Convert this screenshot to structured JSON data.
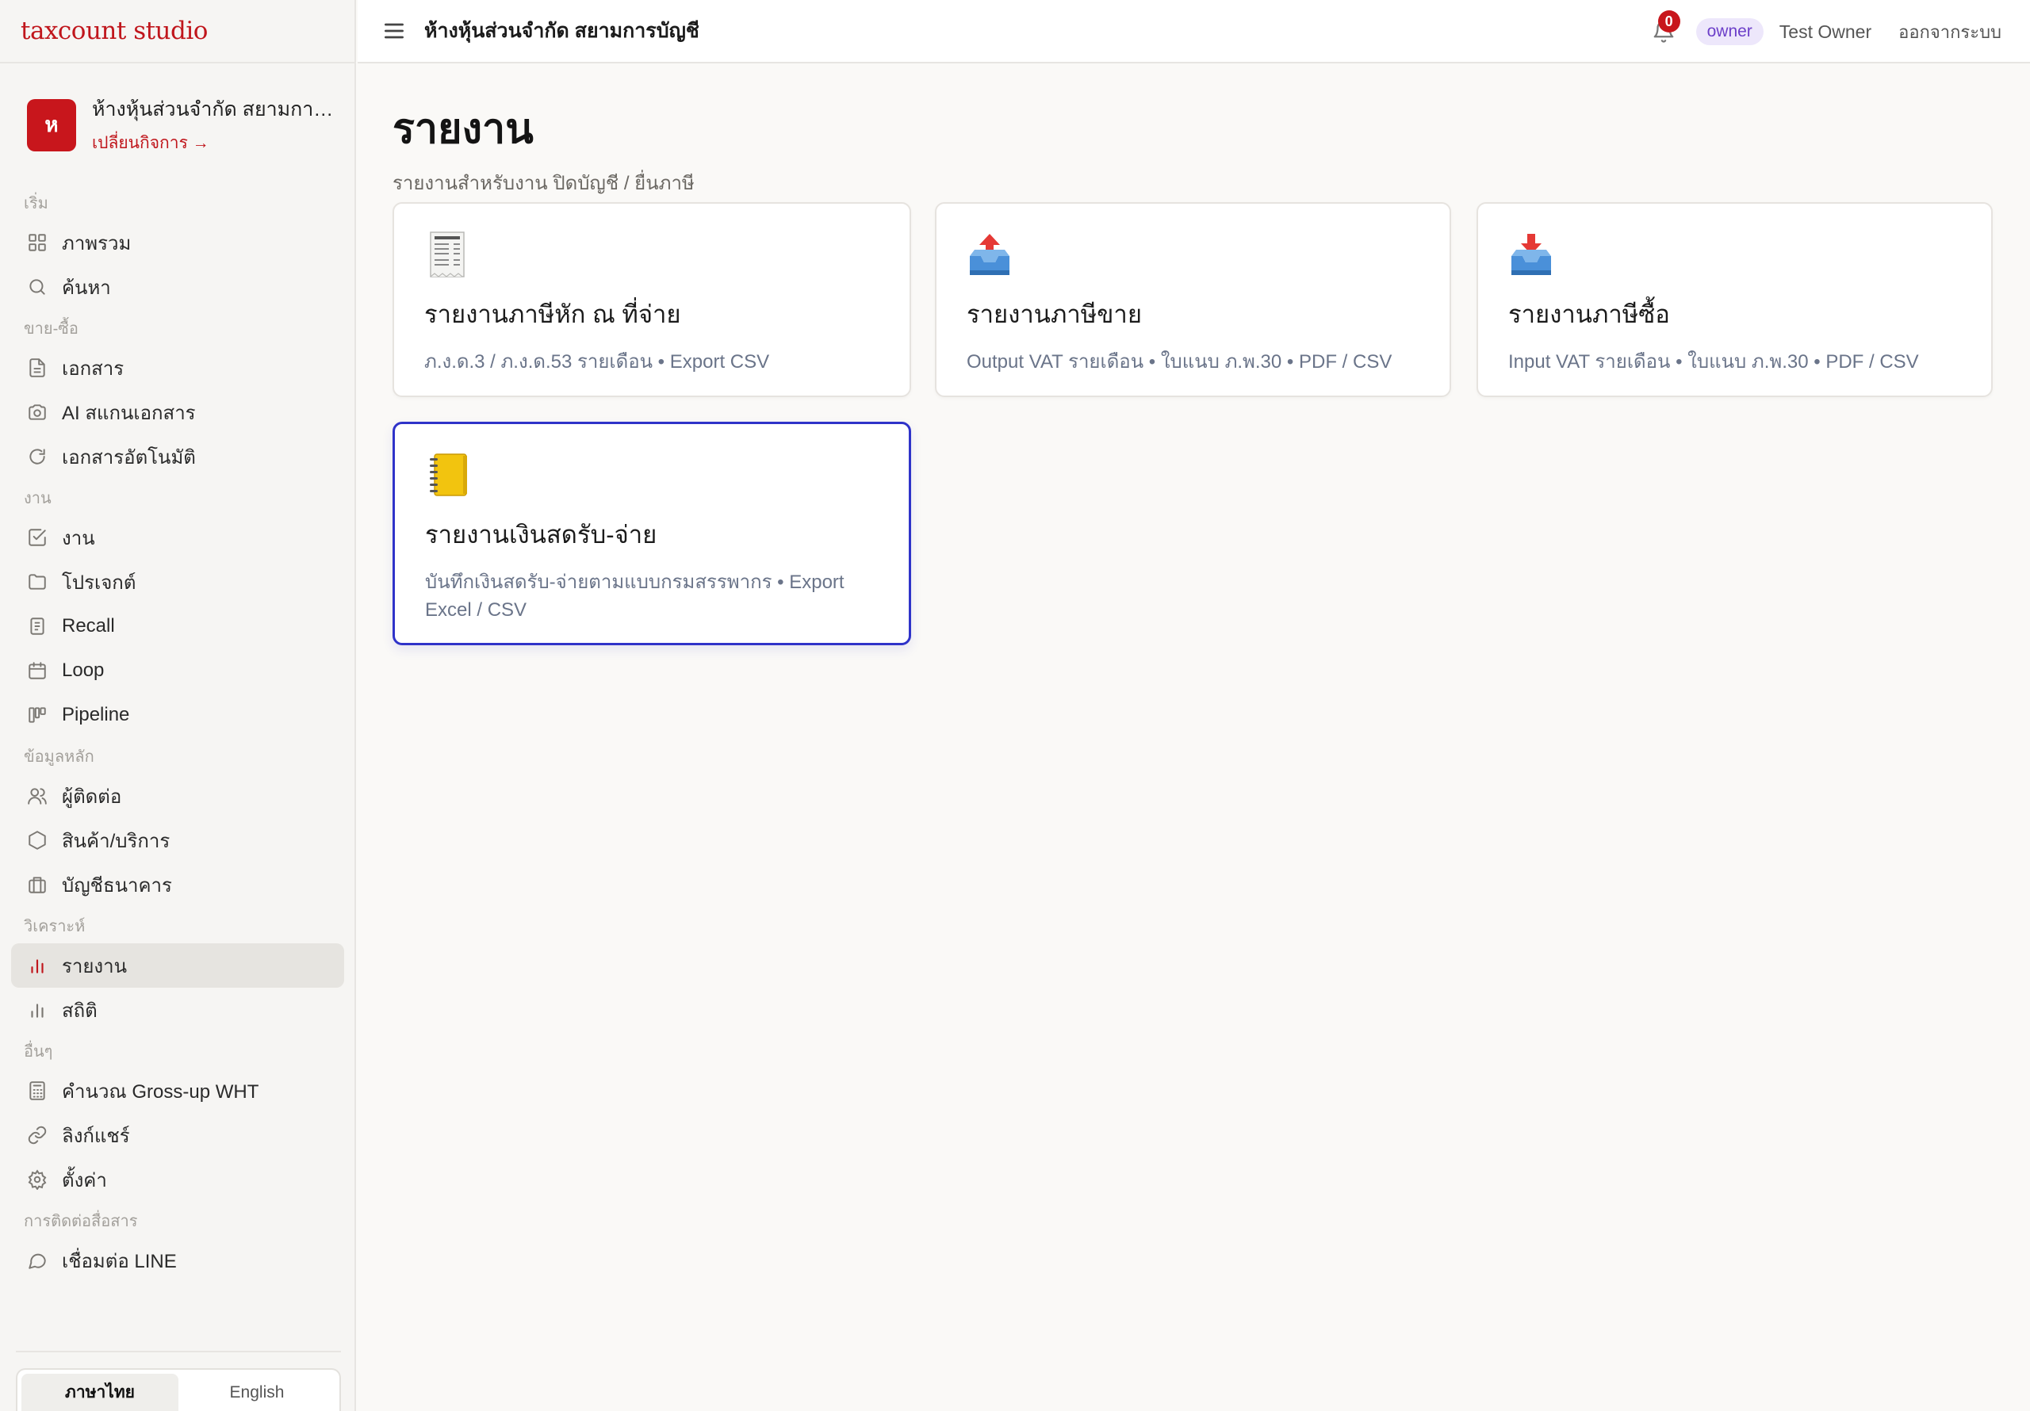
{
  "app": {
    "brand": "taxcount studio"
  },
  "business": {
    "avatar_letter": "ห",
    "name": "ห้างหุ้นส่วนจำกัด สยามการ...",
    "switch_label": "เปลี่ยนกิจการ →"
  },
  "nav": {
    "groups": [
      {
        "label": "เริ่ม",
        "items": [
          {
            "label": "ภาพรวม",
            "icon": "grid-icon"
          },
          {
            "label": "ค้นหา",
            "icon": "search-icon"
          }
        ]
      },
      {
        "label": "ขาย-ซื้อ",
        "items": [
          {
            "label": "เอกสาร",
            "icon": "document-icon"
          },
          {
            "label": "AI สแกนเอกสาร",
            "icon": "camera-icon"
          },
          {
            "label": "เอกสารอัตโนมัติ",
            "icon": "refresh-icon"
          }
        ]
      },
      {
        "label": "งาน",
        "items": [
          {
            "label": "งาน",
            "icon": "check-square-icon"
          },
          {
            "label": "โปรเจกต์",
            "icon": "folder-icon"
          },
          {
            "label": "Recall",
            "icon": "receipt-icon"
          },
          {
            "label": "Loop",
            "icon": "calendar-icon"
          },
          {
            "label": "Pipeline",
            "icon": "kanban-icon"
          }
        ]
      },
      {
        "label": "ข้อมูลหลัก",
        "items": [
          {
            "label": "ผู้ติดต่อ",
            "icon": "users-icon"
          },
          {
            "label": "สินค้า/บริการ",
            "icon": "hexagon-icon"
          },
          {
            "label": "บัญชีธนาคาร",
            "icon": "briefcase-icon"
          }
        ]
      },
      {
        "label": "วิเคราะห์",
        "items": [
          {
            "label": "รายงาน",
            "icon": "bar-chart-icon",
            "active": true
          },
          {
            "label": "สถิติ",
            "icon": "bar-chart-icon"
          }
        ]
      },
      {
        "label": "อื่นๆ",
        "items": [
          {
            "label": "คำนวณ Gross-up WHT",
            "icon": "calculator-icon"
          },
          {
            "label": "ลิงก์แชร์",
            "icon": "link-icon"
          },
          {
            "label": "ตั้งค่า",
            "icon": "gear-icon"
          }
        ]
      },
      {
        "label": "การติดต่อสื่อสาร",
        "items": [
          {
            "label": "เชื่อมต่อ LINE",
            "icon": "chat-icon"
          }
        ]
      }
    ]
  },
  "language": {
    "thai": "ภาษาไทย",
    "english": "English",
    "selected": "thai"
  },
  "topbar": {
    "title": "ห้างหุ้นส่วนจำกัด สยามการบัญชี",
    "notification_count": "0",
    "role": "owner",
    "user_name": "Test Owner",
    "logout": "ออกจากระบบ"
  },
  "page": {
    "title": "รายงาน",
    "subtitle": "รายงานสำหรับงาน ปิดบัญชี / ยื่นภาษี"
  },
  "cards": [
    {
      "icon": "receipt-icon",
      "title": "รายงานภาษีหัก ณ ที่จ่าย",
      "desc": "ภ.ง.ด.3 / ภ.ง.ด.53 รายเดือน • Export CSV"
    },
    {
      "icon": "outbox-tray-icon",
      "title": "รายงานภาษีขาย",
      "desc": "Output VAT รายเดือน • ใบแนบ ภ.พ.30 • PDF / CSV"
    },
    {
      "icon": "inbox-tray-icon",
      "title": "รายงานภาษีซื้อ",
      "desc": "Input VAT รายเดือน • ใบแนบ ภ.พ.30 • PDF / CSV"
    },
    {
      "icon": "ledger-notebook-icon",
      "title": "รายงานเงินสดรับ-จ่าย",
      "desc": "บันทึกเงินสดรับ-จ่ายตามแบบกรมสรรพากร • Export Excel / CSV",
      "selected": true
    }
  ],
  "colors": {
    "brand": "#c0161c",
    "selection": "#2f33c9",
    "role_pill": "#ede7fb"
  }
}
